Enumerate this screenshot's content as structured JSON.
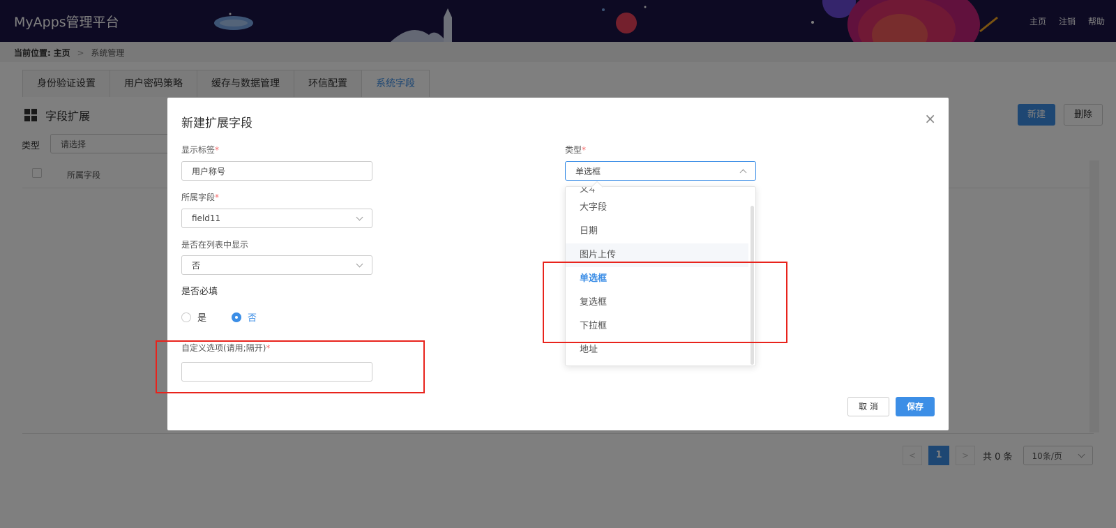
{
  "header": {
    "app_title": "MyApps管理平台",
    "nav": [
      "主页",
      "注销",
      "帮助"
    ]
  },
  "breadcrumb": {
    "label": "当前位置:",
    "home": "主页",
    "separator": ">",
    "current": "系统管理"
  },
  "tabs": [
    {
      "label": "身份验证设置",
      "active": false
    },
    {
      "label": "用户密码策略",
      "active": false
    },
    {
      "label": "缓存与数据管理",
      "active": false
    },
    {
      "label": "环信配置",
      "active": false
    },
    {
      "label": "系统字段",
      "active": true
    }
  ],
  "section": {
    "title": "字段扩展",
    "new_label": "新建",
    "delete_label": "删除"
  },
  "filter": {
    "label": "类型",
    "placeholder": "请选择"
  },
  "table": {
    "columns": [
      "所属字段"
    ]
  },
  "pagination": {
    "prev": "<",
    "current_page": "1",
    "next": ">",
    "total": "共 0 条",
    "page_size": "10条/页"
  },
  "dialog": {
    "title": "新建扩展字段",
    "close": "×",
    "display_label": {
      "label": "显示标签",
      "value": "用户称号"
    },
    "field": {
      "label": "所属字段",
      "value": "field11"
    },
    "show_in_list": {
      "label": "是否在列表中显示",
      "value": "否"
    },
    "required": {
      "label": "是否必填",
      "options": [
        "是",
        "否"
      ],
      "selected": "否"
    },
    "custom_options": {
      "label": "自定义选项(请用;隔开)",
      "value": ""
    },
    "type": {
      "label": "类型",
      "value": "单选框",
      "peek": "文本",
      "options": [
        "大字段",
        "日期",
        "图片上传",
        "单选框",
        "复选框",
        "下拉框",
        "地址"
      ],
      "hovered": "图片上传"
    },
    "cancel_label": "取 消",
    "save_label": "保存"
  },
  "colors": {
    "accent": "#3c8ee6",
    "header_bg": "#1a1446",
    "highlight": "#e8231c",
    "required": "#f56c6c"
  }
}
